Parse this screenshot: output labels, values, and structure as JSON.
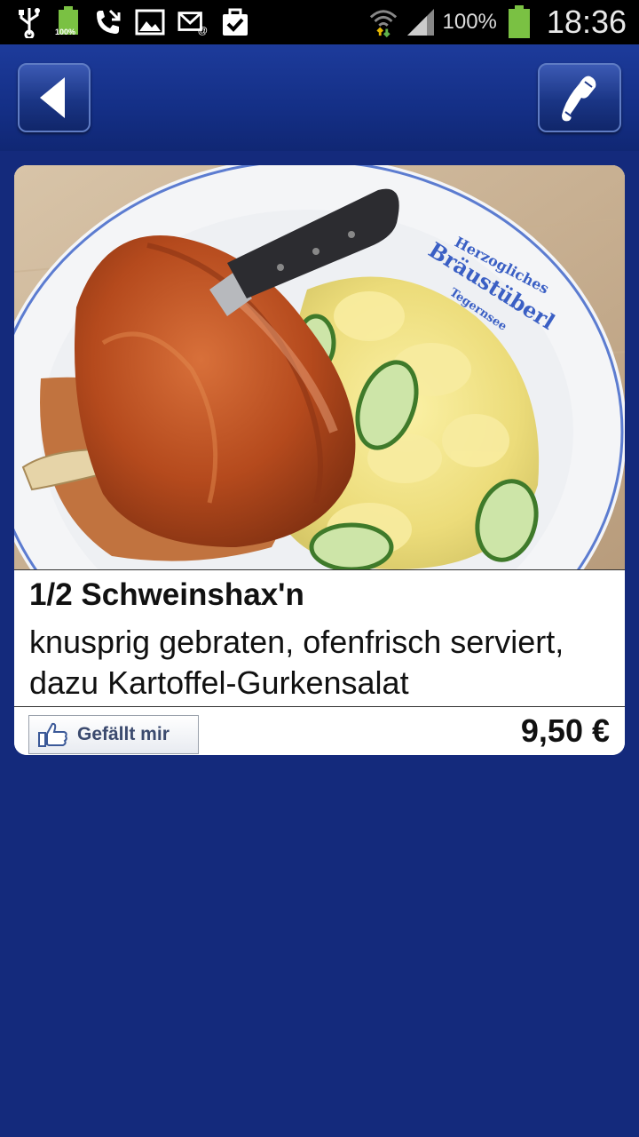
{
  "status_bar": {
    "small_battery_label": "100%",
    "battery_percent": "100%",
    "time": "18:36",
    "icons": [
      "usb-icon",
      "battery-icon",
      "missed-call-icon",
      "gallery-icon",
      "email-icon",
      "task-icon",
      "wifi-icon",
      "signal-icon"
    ]
  },
  "header": {
    "back_icon": "back-arrow-icon",
    "call_icon": "phone-icon"
  },
  "dish": {
    "title": "1/2 Schweinshax'n",
    "description": "knusprig gebraten, ofenfrisch serviert, dazu Kartoffel-Gurkensalat",
    "price": "9,50 €",
    "like_label": "Gefällt mir",
    "plate_text": [
      "Herzogliches",
      "Bräustüberl",
      "Tegernsee"
    ]
  },
  "colors": {
    "background": "#142a7c",
    "header": "#1a3590",
    "battery_green": "#7ac143"
  }
}
